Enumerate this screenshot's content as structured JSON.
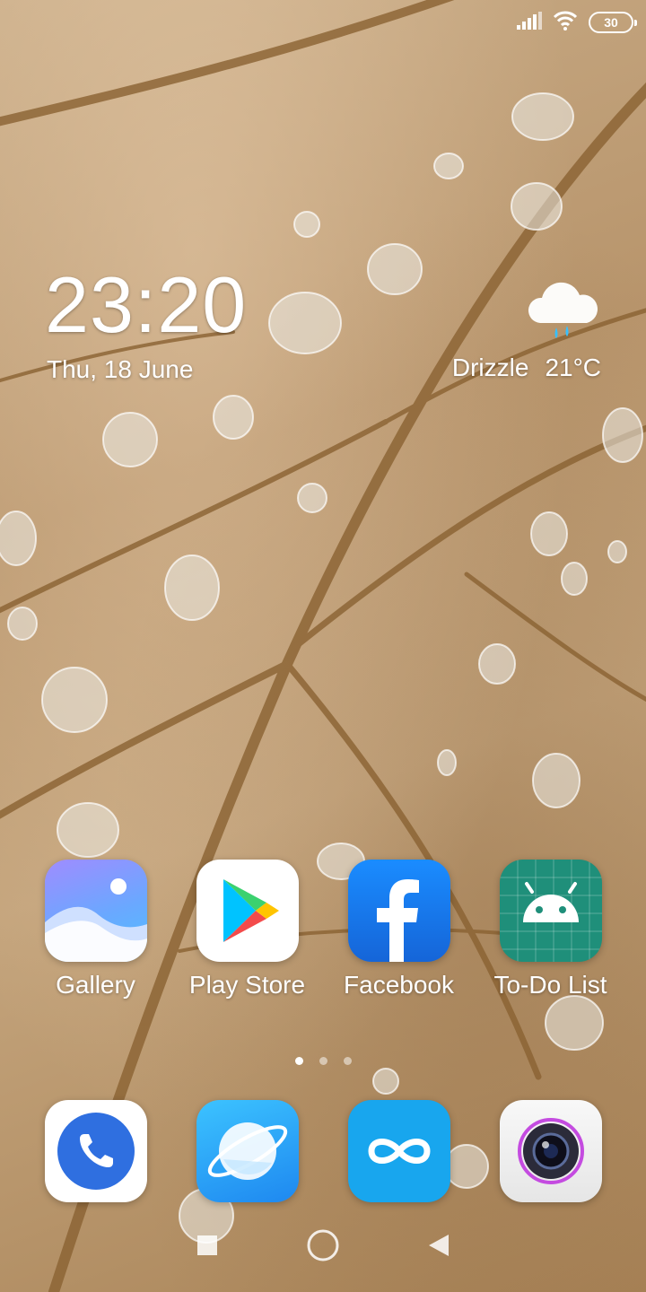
{
  "status_bar": {
    "signal_icon": "signal-icon",
    "wifi_icon": "wifi-icon",
    "battery_level": "30"
  },
  "clock_widget": {
    "time": "23:20",
    "date": "Thu, 18 June"
  },
  "weather_widget": {
    "icon": "drizzle-cloud-icon",
    "condition": "Drizzle",
    "temperature": "21°C"
  },
  "apps": [
    {
      "label": "Gallery",
      "icon": "gallery-icon"
    },
    {
      "label": "Play Store",
      "icon": "play-store-icon"
    },
    {
      "label": "Facebook",
      "icon": "facebook-icon"
    },
    {
      "label": "To-Do List",
      "icon": "android-icon"
    }
  ],
  "page_indicator": {
    "pages": 3,
    "active": 1
  },
  "dock": [
    {
      "icon": "phone-icon"
    },
    {
      "icon": "browser-icon"
    },
    {
      "icon": "infinity-icon"
    },
    {
      "icon": "camera-icon"
    }
  ],
  "nav_bar": {
    "recents": "recents-square-icon",
    "home": "home-circle-icon",
    "back": "back-triangle-icon"
  },
  "colors": {
    "facebook_blue": "#1877f2",
    "todo_green": "#1f8f7a",
    "phone_blue": "#2f6fe0",
    "browser_blue": "#1e9cf0"
  }
}
